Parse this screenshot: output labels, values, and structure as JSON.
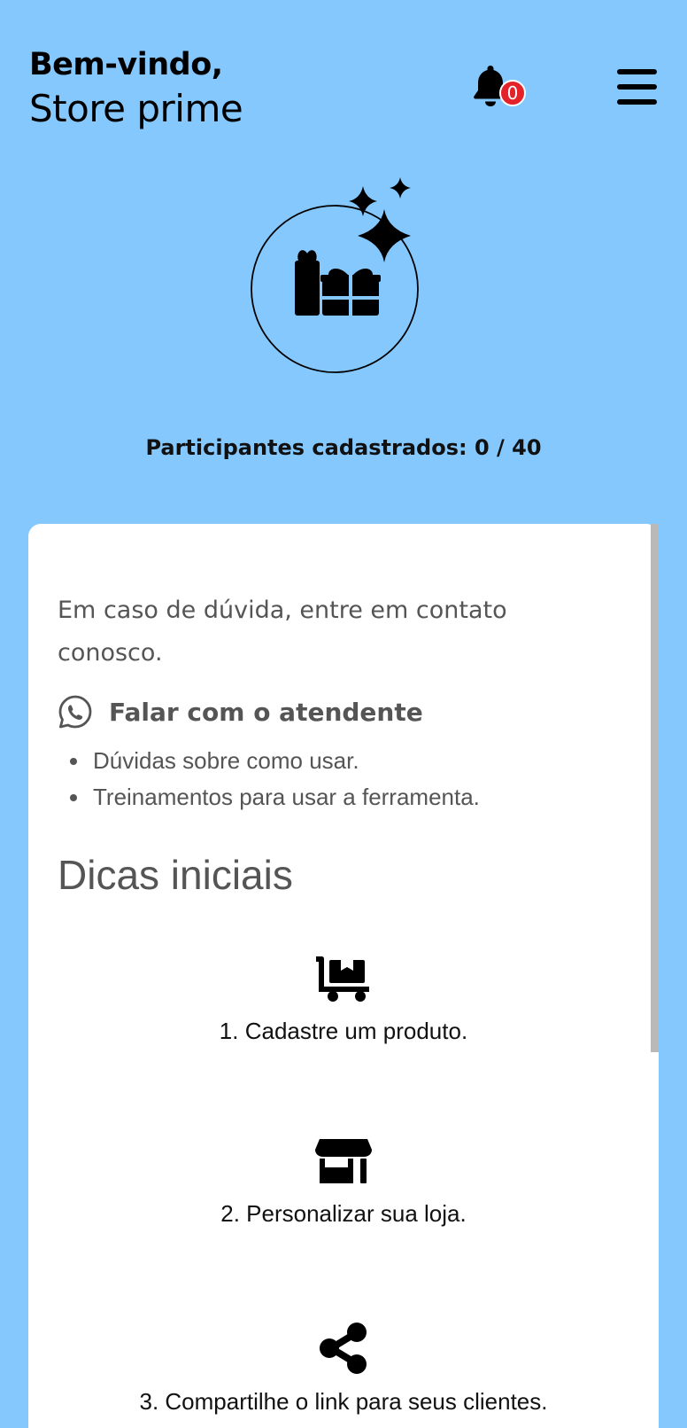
{
  "header": {
    "greeting": "Bem-vindo,",
    "store_name": "Store prime",
    "notification_count": "0"
  },
  "participants": {
    "label": "Participantes cadastrados:",
    "current": "0",
    "separator": "/",
    "total": "40"
  },
  "help": {
    "text": "Em caso de dúvida, entre em contato conosco.",
    "whatsapp_label": "Falar com o atendente",
    "items": [
      "Dúvidas sobre como usar.",
      "Treinamentos para usar a ferramenta."
    ]
  },
  "tips": {
    "title": "Dicas iniciais",
    "items": [
      {
        "label": "1. Cadastre um produto.",
        "icon": "cart-flatbed-icon"
      },
      {
        "label": "2. Personalizar sua loja.",
        "icon": "store-icon"
      },
      {
        "label": "3. Compartilhe o link para seus clientes.",
        "icon": "share-icon"
      }
    ]
  },
  "colors": {
    "background": "#85c8fe",
    "card": "#ffffff",
    "badge": "#e3222a",
    "muted_text": "#555555"
  }
}
